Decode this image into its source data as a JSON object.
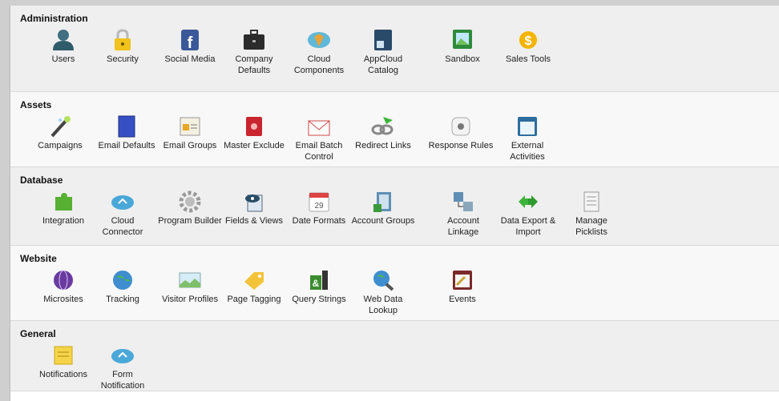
{
  "sections": [
    {
      "title": "Administration",
      "items": [
        "Users",
        "Security",
        "Social Media",
        "Company\nDefaults",
        "Cloud\nComponents",
        "AppCloud\nCatalog",
        "Sandbox",
        "Sales Tools"
      ]
    },
    {
      "title": "Assets",
      "items": [
        "Campaigns",
        "Email Defaults",
        "Email Groups",
        "Master Exclude",
        "Email Batch\nControl",
        "Redirect Links",
        "Response Rules",
        "External\nActivities"
      ]
    },
    {
      "title": "Database",
      "items": [
        "Integration",
        "Cloud Connector",
        "Program Builder",
        "Fields & Views",
        "Date Formats",
        "Account Groups",
        "Account\nLinkage",
        "Data Export &\nImport",
        "Manage Picklists"
      ]
    },
    {
      "title": "Website",
      "items": [
        "Microsites",
        "Tracking",
        "Visitor Profiles",
        "Page Tagging",
        "Query Strings",
        "Web Data\nLookup",
        "Events"
      ]
    },
    {
      "title": "General",
      "items": [
        "Notifications",
        "Form Notification"
      ]
    }
  ],
  "date_icon_day": "29",
  "icons": {
    "administration": [
      "users-icon",
      "lock-icon",
      "facebook-icon",
      "briefcase-icon",
      "cloud-components-icon",
      "appcloud-catalog-icon",
      "sandbox-icon",
      "sales-tools-icon"
    ],
    "assets": [
      "magic-wand-icon",
      "email-template-icon",
      "email-groups-icon",
      "master-exclude-icon",
      "envelope-icon",
      "redirect-links-icon",
      "response-rules-icon",
      "calendar-activity-icon"
    ],
    "database": [
      "puzzle-icon",
      "cloud-connector-icon",
      "gear-icon",
      "fields-views-icon",
      "calendar-icon",
      "account-groups-icon",
      "account-linkage-icon",
      "export-import-icon",
      "picklist-icon"
    ],
    "website": [
      "globe-icon",
      "tracking-globe-icon",
      "visitor-profiles-icon",
      "tag-icon",
      "query-strings-icon",
      "web-lookup-icon",
      "events-calendar-icon"
    ],
    "general": [
      "notification-note-icon",
      "form-notification-cloud-icon"
    ]
  }
}
